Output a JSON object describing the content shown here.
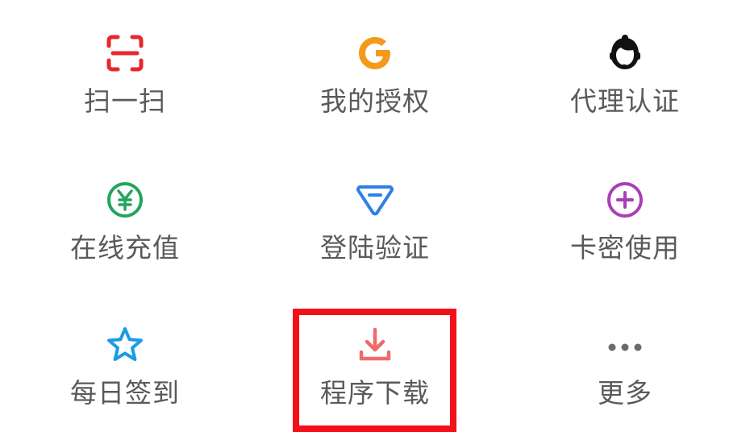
{
  "menu": {
    "items": [
      {
        "label": "扫一扫",
        "icon": "scan-icon",
        "color": "#e8262b"
      },
      {
        "label": "我的授权",
        "icon": "google-g-icon",
        "color": "#f39a1b"
      },
      {
        "label": "代理认证",
        "icon": "customer-service-icon",
        "color": "#111111"
      },
      {
        "label": "在线充值",
        "icon": "yuan-coin-icon",
        "color": "#22a55b"
      },
      {
        "label": "登陆验证",
        "icon": "diamond-icon",
        "color": "#2f7fe8"
      },
      {
        "label": "卡密使用",
        "icon": "plus-circle-icon",
        "color": "#a93fb6"
      },
      {
        "label": "每日签到",
        "icon": "star-icon",
        "color": "#1a9be6"
      },
      {
        "label": "程序下载",
        "icon": "download-icon",
        "color": "#f06a6a"
      },
      {
        "label": "更多",
        "icon": "more-dots-icon",
        "color": "#6b6b6b"
      }
    ]
  },
  "highlight": {
    "color": "#f3101a",
    "target": "程序下载"
  }
}
